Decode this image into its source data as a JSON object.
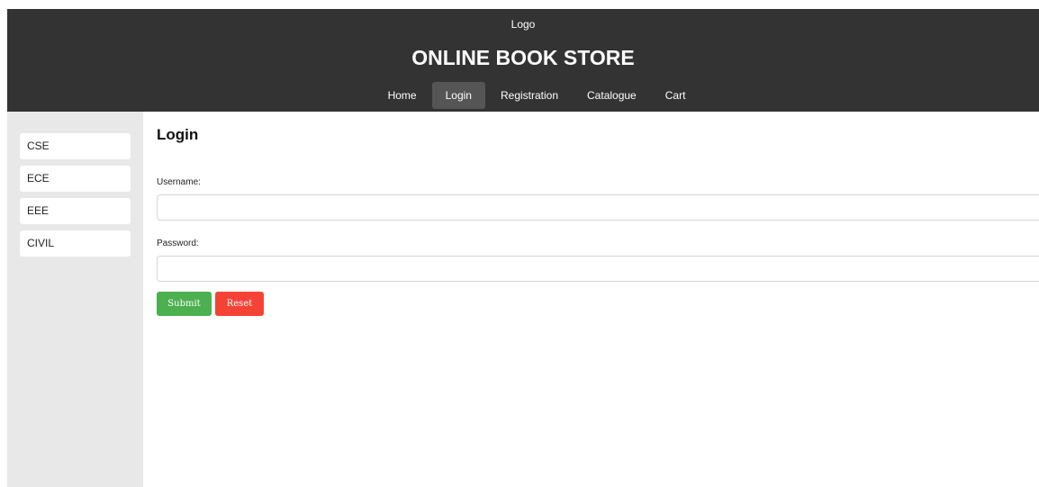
{
  "header": {
    "logo_text": "Logo",
    "title": "ONLINE BOOK STORE",
    "bg_color": "#333333"
  },
  "nav": {
    "items": [
      {
        "label": "Home",
        "active": false
      },
      {
        "label": "Login",
        "active": true
      },
      {
        "label": "Registration",
        "active": false
      },
      {
        "label": "Catalogue",
        "active": false
      },
      {
        "label": "Cart",
        "active": false
      }
    ]
  },
  "sidebar": {
    "items": [
      {
        "label": "CSE"
      },
      {
        "label": "ECE"
      },
      {
        "label": "EEE"
      },
      {
        "label": "CIVIL"
      }
    ]
  },
  "main": {
    "title": "Login",
    "username_label": "Username:",
    "username_value": "",
    "password_label": "Password:",
    "password_value": "",
    "submit_label": "Submit",
    "reset_label": "Reset"
  },
  "colors": {
    "submit": "#4caf50",
    "reset": "#f44336",
    "sidebar_bg": "#e8e8e8"
  }
}
